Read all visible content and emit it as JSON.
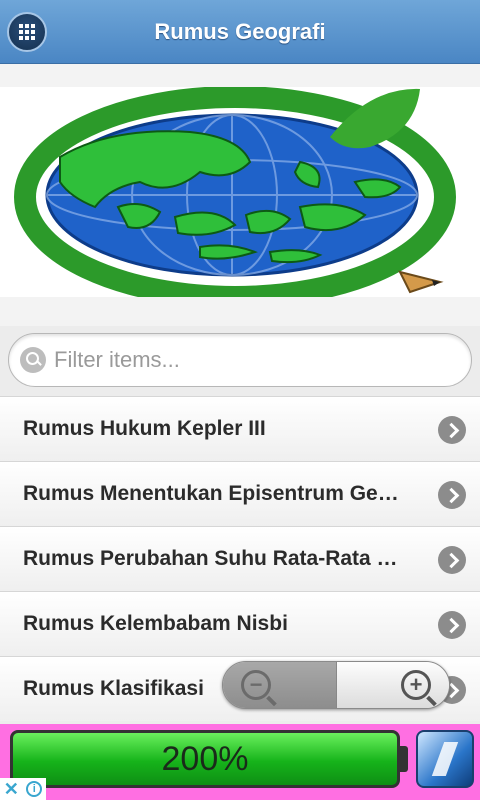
{
  "header": {
    "title": "Rumus Geografi",
    "menu_icon": "grid-icon"
  },
  "logo": {
    "icon": "globe-leaf-logo",
    "colors": {
      "ocean": "#1f62c9",
      "land": "#2fbf3a",
      "ring": "#2c9a2a",
      "leaf": "#39a830"
    }
  },
  "search": {
    "placeholder": "Filter items...",
    "value": ""
  },
  "list": {
    "items": [
      {
        "label": "Rumus Hukum Kepler III"
      },
      {
        "label": "Rumus Menentukan Episentrum Ge…"
      },
      {
        "label": "Rumus Perubahan Suhu Rata-Rata …"
      },
      {
        "label": "Rumus Kelembabam Nisbi"
      },
      {
        "label": "Rumus Klasifikasi"
      }
    ]
  },
  "zoom": {
    "out_icon": "zoom-out-icon",
    "in_icon": "zoom-in-icon",
    "out_symbol": "−",
    "in_symbol": "+"
  },
  "ad": {
    "battery_text": "200%",
    "background": "#ff6fe2",
    "battery_color": "#16b31a",
    "close_symbol": "✕",
    "info_symbol": "i"
  }
}
